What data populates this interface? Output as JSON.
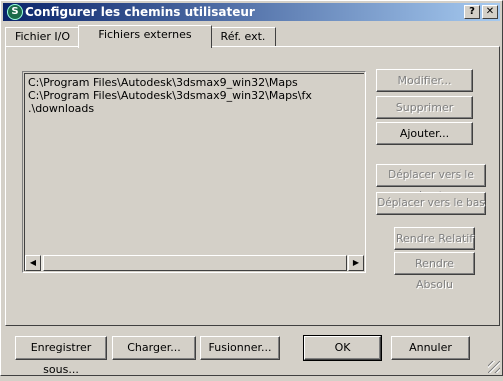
{
  "window": {
    "title": "Configurer les chemins utilisateur",
    "help_label": "?",
    "close_label": "✕"
  },
  "tabs": [
    {
      "label": "Fichier I/O",
      "active": false
    },
    {
      "label": "Fichiers externes",
      "active": true
    },
    {
      "label": "Réf. ext.",
      "active": false
    }
  ],
  "paths": [
    "C:\\Program Files\\Autodesk\\3dsmax9_win32\\Maps",
    "C:\\Program Files\\Autodesk\\3dsmax9_win32\\Maps\\fx",
    ".\\downloads"
  ],
  "side_buttons": {
    "modify": "Modifier...",
    "delete": "Supprimer",
    "add": "Ajouter...",
    "move_up": "Déplacer vers le haut",
    "move_down": "Déplacer vers le bas",
    "make_relative": "Rendre Relatif",
    "make_absolute": "Rendre Absolu"
  },
  "bottom_buttons": {
    "save_as": "Enregistrer sous...",
    "load": "Charger...",
    "merge": "Fusionner...",
    "ok": "OK",
    "cancel": "Annuler"
  },
  "icons": {
    "app": "3ds-max-icon",
    "scroll_left": "◀",
    "scroll_right": "▶"
  }
}
